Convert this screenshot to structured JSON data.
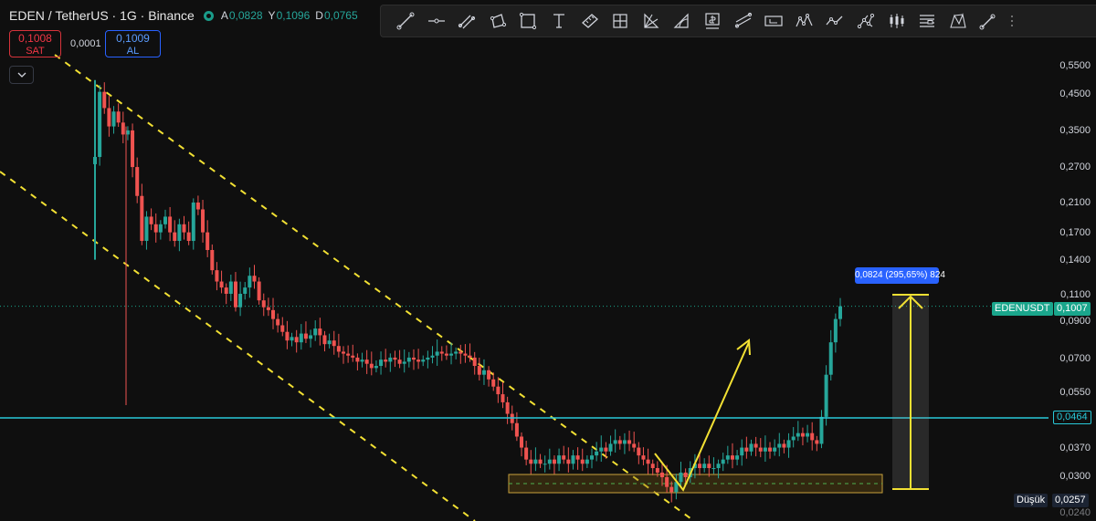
{
  "header": {
    "symbol": "EDEN / TetherUS · 1G · Binance",
    "ohlc": [
      {
        "key": "A",
        "value": "0,0828"
      },
      {
        "key": "Y",
        "value": "0,1096"
      },
      {
        "key": "D",
        "value": "0,0765"
      }
    ]
  },
  "trade": {
    "sell_price": "0,1008",
    "sell_label": "SAT",
    "spread": "0,0001",
    "buy_price": "0,1009",
    "buy_label": "AL"
  },
  "toolbar": {
    "tools": [
      "trend-line-icon",
      "horizontal-ray-icon",
      "parallel-channel-icon",
      "rectangle-rotated-icon",
      "rectangle-icon",
      "text-cursor-icon",
      "ruler-icon",
      "grid-fib-icon",
      "gann-icon",
      "arc-icon",
      "price-note-icon",
      "long-position-icon",
      "ruler-flat-icon",
      "elliott-wave-icon",
      "zigzag-icon",
      "network-icon",
      "candles-icon",
      "table-icon",
      "xabcd-pattern-icon",
      "brush-icon"
    ]
  },
  "price_axis": {
    "ticks": [
      "0,5500",
      "0,4500",
      "0,3500",
      "0,2700",
      "0,2100",
      "0,1700",
      "0,1400",
      "0,1100",
      "0,0900",
      "0,0700",
      "0,0550",
      "0,0370",
      "0,0300",
      "0,0240"
    ],
    "current_symbol": "EDENUSDT",
    "current_price": "0,1007",
    "level_price": "0,0464",
    "low_label": "Düşük",
    "low_price": "0,0257"
  },
  "measure": {
    "label": "0,0824 (295,65%) 824"
  },
  "colors": {
    "up": "#26a69a",
    "down": "#ef5350",
    "channel": "#f2e033",
    "horizontal_line": "#28c8d8",
    "measure": "#2962ff",
    "arrow": "#f2e033"
  },
  "chart_data": {
    "type": "candlestick",
    "scale": "log",
    "ylim": [
      0.024,
      0.6
    ],
    "x_count": 160,
    "close": [
      0.29,
      0.46,
      0.41,
      0.36,
      0.4,
      0.37,
      0.34,
      0.35,
      0.27,
      0.22,
      0.16,
      0.19,
      0.18,
      0.17,
      0.18,
      0.19,
      0.17,
      0.16,
      0.18,
      0.17,
      0.16,
      0.21,
      0.2,
      0.17,
      0.15,
      0.13,
      0.12,
      0.115,
      0.11,
      0.12,
      0.1,
      0.11,
      0.115,
      0.125,
      0.12,
      0.105,
      0.1,
      0.098,
      0.092,
      0.088,
      0.084,
      0.079,
      0.081,
      0.078,
      0.083,
      0.08,
      0.082,
      0.086,
      0.082,
      0.077,
      0.079,
      0.076,
      0.073,
      0.072,
      0.071,
      0.07,
      0.068,
      0.069,
      0.067,
      0.065,
      0.066,
      0.069,
      0.068,
      0.07,
      0.069,
      0.067,
      0.068,
      0.07,
      0.069,
      0.068,
      0.069,
      0.07,
      0.071,
      0.073,
      0.072,
      0.071,
      0.072,
      0.073,
      0.072,
      0.071,
      0.07,
      0.066,
      0.062,
      0.064,
      0.06,
      0.057,
      0.054,
      0.051,
      0.047,
      0.044,
      0.04,
      0.037,
      0.034,
      0.033,
      0.034,
      0.033,
      0.033,
      0.034,
      0.033,
      0.035,
      0.034,
      0.033,
      0.035,
      0.034,
      0.033,
      0.034,
      0.035,
      0.036,
      0.037,
      0.036,
      0.038,
      0.039,
      0.038,
      0.039,
      0.038,
      0.037,
      0.035,
      0.034,
      0.033,
      0.032,
      0.031,
      0.03,
      0.028,
      0.027,
      0.029,
      0.031,
      0.03,
      0.032,
      0.033,
      0.032,
      0.033,
      0.032,
      0.032,
      0.033,
      0.034,
      0.035,
      0.034,
      0.035,
      0.037,
      0.036,
      0.038,
      0.037,
      0.036,
      0.037,
      0.036,
      0.037,
      0.038,
      0.037,
      0.039,
      0.04,
      0.041,
      0.04,
      0.041,
      0.039,
      0.038,
      0.046,
      0.062,
      0.078,
      0.092,
      0.1007
    ]
  }
}
